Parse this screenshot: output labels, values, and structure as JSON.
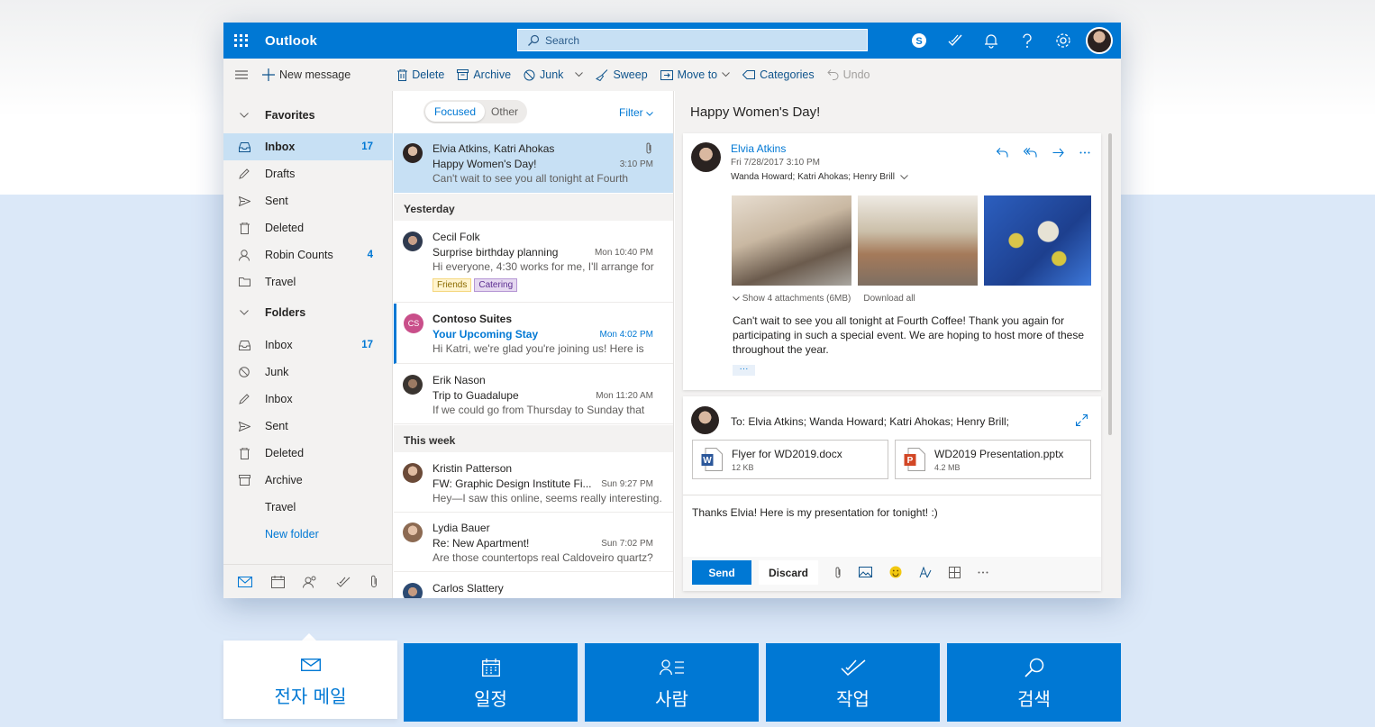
{
  "header": {
    "app_name": "Outlook",
    "search_placeholder": "Search"
  },
  "commands": {
    "new_message": "New message",
    "delete": "Delete",
    "archive": "Archive",
    "junk": "Junk",
    "sweep": "Sweep",
    "move_to": "Move to",
    "categories": "Categories",
    "undo": "Undo"
  },
  "nav": {
    "favorites": "Favorites",
    "fav_items": [
      {
        "label": "Inbox",
        "count": "17"
      },
      {
        "label": "Drafts",
        "count": ""
      },
      {
        "label": "Sent",
        "count": ""
      },
      {
        "label": "Deleted",
        "count": ""
      },
      {
        "label": "Robin Counts",
        "count": "4"
      },
      {
        "label": "Travel",
        "count": ""
      }
    ],
    "folders": "Folders",
    "folder_items": [
      {
        "label": "Inbox",
        "count": "17"
      },
      {
        "label": "Junk",
        "count": ""
      },
      {
        "label": "Inbox",
        "count": ""
      },
      {
        "label": "Sent",
        "count": ""
      },
      {
        "label": "Deleted",
        "count": ""
      },
      {
        "label": "Archive",
        "count": ""
      },
      {
        "label": "Travel",
        "count": ""
      }
    ],
    "new_folder": "New folder"
  },
  "list": {
    "focused": "Focused",
    "other": "Other",
    "filter": "Filter",
    "groups": {
      "yesterday": "Yesterday",
      "this_week": "This week"
    },
    "messages": [
      {
        "from": "Elvia Atkins, Katri Ahokas",
        "subject": "Happy Women's Day!",
        "preview": "Can't wait to see you all tonight at Fourth",
        "time": "3:10 PM"
      },
      {
        "from": "Cecil Folk",
        "subject": "Surprise birthday planning",
        "preview": "Hi everyone, 4:30 works for me, I'll arrange for",
        "time": "Mon 10:40 PM",
        "tags": [
          "Friends",
          "Catering"
        ]
      },
      {
        "from": "Contoso Suites",
        "subject": "Your Upcoming Stay",
        "preview": "Hi Katri, we're glad you're joining us! Here is",
        "time": "Mon 4:02 PM",
        "initials": "CS"
      },
      {
        "from": "Erik Nason",
        "subject": "Trip to Guadalupe",
        "preview": "If we could go from Thursday to Sunday that",
        "time": "Mon 11:20 AM"
      },
      {
        "from": "Kristin Patterson",
        "subject": "FW: Graphic Design Institute Fi...",
        "preview": "Hey—I saw this online, seems really interesting.",
        "time": "Sun 9:27 PM"
      },
      {
        "from": "Lydia Bauer",
        "subject": "Re: New Apartment!",
        "preview": "Are those countertops real Caldoveiro quartz?",
        "time": "Sun 7:02 PM"
      },
      {
        "from": "Carlos Slattery",
        "subject": "",
        "preview": "",
        "time": ""
      }
    ]
  },
  "reading": {
    "title": "Happy Women's Day!",
    "sender": "Elvia Atkins",
    "date": "Fri 7/28/2017 3:10 PM",
    "recipients": "Wanda Howard; Katri Ahokas; Henry Brill",
    "show_attachments": "Show 4 attachments (6MB)",
    "download_all": "Download all",
    "body": "Can't wait to see you all tonight at Fourth Coffee! Thank you again for participating in such a special event. We are hoping to host more of these throughout the year.",
    "more": "···",
    "reply": {
      "to": "To: Elvia Atkins; Wanda Howard; Katri Ahokas; Henry Brill;",
      "attachments": [
        {
          "name": "Flyer for WD2019.docx",
          "size": "12 KB"
        },
        {
          "name": "WD2019 Presentation.pptx",
          "size": "4.2 MB"
        }
      ],
      "body": "Thanks Elvia! Here is my presentation for tonight! :)",
      "send": "Send",
      "discard": "Discard"
    }
  },
  "tabs": [
    {
      "label": "전자 메일"
    },
    {
      "label": "일정"
    },
    {
      "label": "사람"
    },
    {
      "label": "작업"
    },
    {
      "label": "검색"
    }
  ],
  "colors": {
    "brand": "#0078d4",
    "selection": "#c7e0f4",
    "contoso": "#c94f8a"
  }
}
